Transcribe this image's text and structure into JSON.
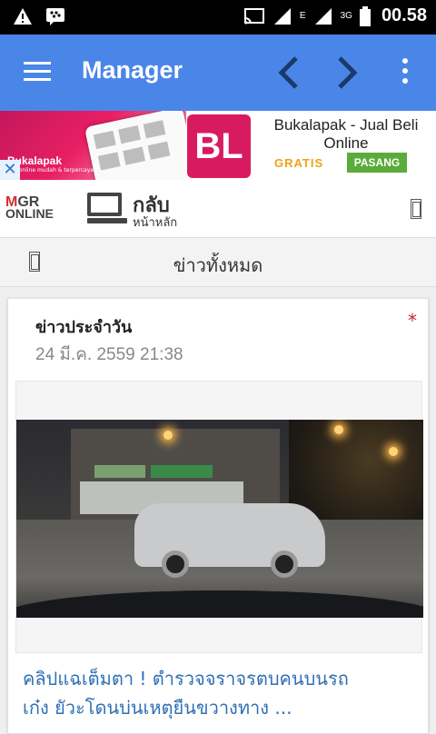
{
  "status_bar": {
    "time": "00.58",
    "network_type": "E",
    "data_type": "3G",
    "icons": [
      "alert-icon",
      "bbm-icon",
      "cast-icon",
      "signal-icon",
      "signal-icon",
      "battery-icon"
    ]
  },
  "app_bar": {
    "title": "Manager",
    "color": "#4a86e8",
    "icons": [
      "menu-icon",
      "chevron-left-icon",
      "chevron-right-icon",
      "more-vert-icon"
    ]
  },
  "ad": {
    "brand_text": "Bukalapak",
    "tagline": "beli online mudah & terpercaya",
    "logo_text": "BL",
    "title": "Bukalapak - Jual Beli Online",
    "price": "GRATIS",
    "install_label": "PASANG",
    "close_glyph": "✕"
  },
  "site_header": {
    "logo_line1_a": "M",
    "logo_line1_b": "GR",
    "logo_line2": "ONLINE",
    "home_main": "กลับ",
    "home_sub": "หน้าหลัก"
  },
  "section": {
    "title": "ข่าวทั้งหมด"
  },
  "card": {
    "title": "ข่าวประจำวัน",
    "date": "24 มี.ค. 2559 21:38",
    "star": "*",
    "headline_line1": "คลิปแฉเต็มตา ! ตำรวจจราจรตบคนบนรถ",
    "headline_line2": "เก๋ง ยัวะโดนบ่นเหตุยืนขวางทาง ..."
  }
}
